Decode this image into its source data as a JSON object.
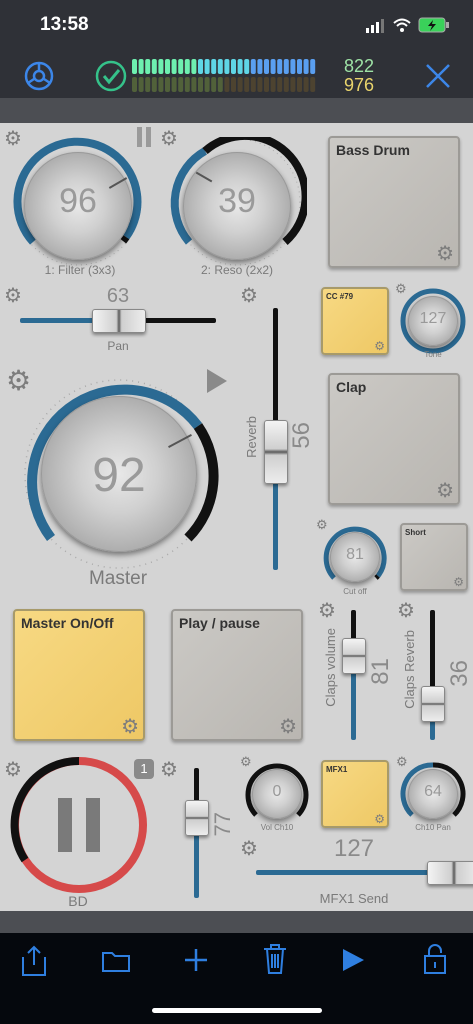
{
  "status": {
    "time": "13:58"
  },
  "header": {
    "count_top": "822",
    "count_bottom": "976"
  },
  "knobs": {
    "filter": {
      "value": "96",
      "label": "1: Filter (3x3)"
    },
    "reso": {
      "value": "39",
      "label": "2: Reso (2x2)"
    },
    "master": {
      "value": "92",
      "label": "Master"
    },
    "tone": {
      "value": "127",
      "label": "Tone"
    },
    "cutoff": {
      "value": "81",
      "label": "Cut off"
    },
    "vol_ch10": {
      "value": "0",
      "label": "Vol Ch10"
    },
    "ch10_pan": {
      "value": "64",
      "label": "Ch10 Pan"
    }
  },
  "sliders": {
    "pan": {
      "value": "63",
      "label": "Pan"
    },
    "reverb": {
      "value": "56",
      "label": "Reverb"
    },
    "claps_volume": {
      "value": "81",
      "label": "Claps volume"
    },
    "claps_reverb": {
      "value": "36",
      "label": "Claps Reverb"
    },
    "unnamed": {
      "value": "77"
    },
    "mfx1_send": {
      "value": "127",
      "label": "MFX1 Send"
    }
  },
  "pads": {
    "bass_drum": "Bass Drum",
    "cc79": "CC #79",
    "clap": "Clap",
    "short": "Short",
    "master_onoff": "Master On/Off",
    "play_pause": "Play / pause",
    "mfx1": "MFX1"
  },
  "transport": {
    "label": "BD",
    "badge": "1"
  },
  "colors": {
    "accent": "#2f7fe0",
    "knob_arc": "#2b6a93",
    "yellow_pad": "#f2cf6f"
  },
  "icons": [
    "settings-icon",
    "check-icon",
    "close-icon",
    "share-icon",
    "folder-icon",
    "plus-icon",
    "trash-icon",
    "play-icon",
    "lock-icon",
    "gear-icon",
    "pause-icon"
  ]
}
